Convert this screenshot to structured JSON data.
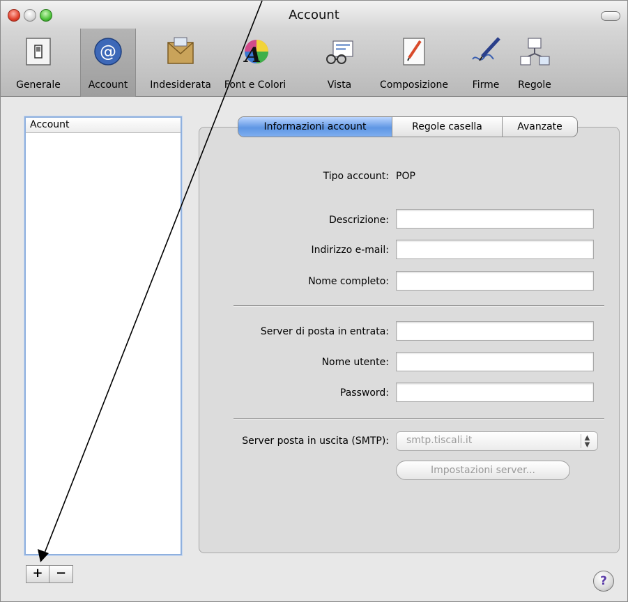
{
  "window": {
    "title": "Account"
  },
  "toolbar": {
    "items": [
      {
        "label": "Generale",
        "icon": "switch-icon"
      },
      {
        "label": "Account",
        "icon": "at-sign-icon",
        "selected": true
      },
      {
        "label": "Indesiderata",
        "icon": "junk-mail-icon"
      },
      {
        "label": "Font e Colori",
        "icon": "font-colors-icon"
      },
      {
        "label": "Vista",
        "icon": "glasses-icon"
      },
      {
        "label": "Composizione",
        "icon": "compose-icon"
      },
      {
        "label": "Firme",
        "icon": "signature-pen-icon"
      },
      {
        "label": "Regole",
        "icon": "rules-icon"
      }
    ]
  },
  "account_list": {
    "header": "Account"
  },
  "list_buttons": {
    "add": "+",
    "remove": "−"
  },
  "tabs": [
    {
      "label": "Informazioni account",
      "active": true
    },
    {
      "label": "Regole casella",
      "active": false
    },
    {
      "label": "Avanzate",
      "active": false
    }
  ],
  "form": {
    "account_type_label": "Tipo account:",
    "account_type_value": "POP",
    "description_label": "Descrizione:",
    "email_label": "Indirizzo e-mail:",
    "full_name_label": "Nome completo:",
    "incoming_server_label": "Server di posta in entrata:",
    "username_label": "Nome utente:",
    "password_label": "Password:",
    "smtp_label": "Server posta in uscita (SMTP):",
    "smtp_value": "smtp.tiscali.it",
    "server_settings_button": "Impostazioni server..."
  },
  "help_button": {
    "label": "?"
  }
}
